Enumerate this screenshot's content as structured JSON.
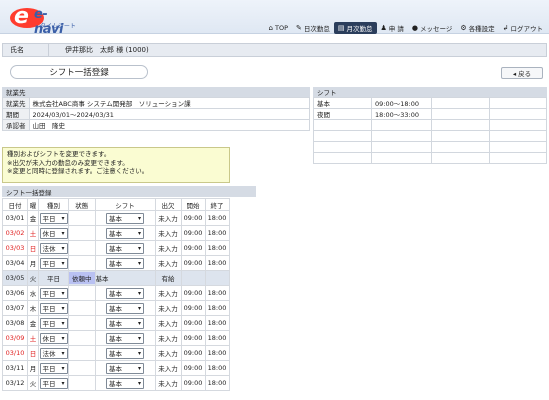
{
  "header": {
    "logo_main": "e-navi",
    "logo_sub": "タイムシート",
    "nav": [
      {
        "icon": "⌂",
        "icon_name": "home-icon",
        "label": "TOP",
        "active": false
      },
      {
        "icon": "✎",
        "icon_name": "pencil-icon",
        "label": "日次勤怠",
        "active": false
      },
      {
        "icon": "▤",
        "icon_name": "calendar-icon",
        "label": "月次勤怠",
        "active": true
      },
      {
        "icon": "♟",
        "icon_name": "person-icon",
        "label": "申 請",
        "active": false
      },
      {
        "icon": "●",
        "icon_name": "chat-icon",
        "label": "メッセージ",
        "active": false
      },
      {
        "icon": "⚙",
        "icon_name": "gear-icon",
        "label": "各種設定",
        "active": false
      },
      {
        "icon": "↲",
        "icon_name": "logout-icon",
        "label": "ログアウト",
        "active": false
      }
    ]
  },
  "user": {
    "label": "氏名",
    "value": "伊井那比　太郎 様 (1000)"
  },
  "page": {
    "title": "シフト一括登録",
    "back_label": "◂ 戻る"
  },
  "employment": {
    "title": "就業先",
    "rows": [
      {
        "key": "就業先",
        "value": "株式会社ABC商事 システム開発部　ソリューション課"
      },
      {
        "key": "期間",
        "value": "2024/03/01～2024/03/31"
      },
      {
        "key": "承認者",
        "value": "山田　隆史"
      }
    ]
  },
  "shift_panel": {
    "title": "シフト",
    "rows": [
      {
        "name": "基本",
        "time": "09:00～18:00"
      },
      {
        "name": "夜間",
        "time": "18:00～33:00"
      },
      {
        "name": "",
        "time": ""
      },
      {
        "name": "",
        "time": ""
      },
      {
        "name": "",
        "time": ""
      },
      {
        "name": "",
        "time": ""
      }
    ]
  },
  "note": {
    "lines": [
      "種別およびシフトを変更できます。",
      "※出欠が未入力の勤怠のみ変更できます。",
      "※変更と同時に登録されます。ご注意ください。"
    ]
  },
  "registration": {
    "title": "シフト一括登録",
    "columns": [
      "日付",
      "曜",
      "種別",
      "状態",
      "シフト",
      "出欠",
      "開始",
      "終了"
    ],
    "rows": [
      {
        "date": "03/01",
        "dow": "金",
        "red": false,
        "type": "平日",
        "status": "",
        "shift": "基本",
        "attendance": "未入力",
        "start": "09:00",
        "end": "18:00",
        "editable": true
      },
      {
        "date": "03/02",
        "dow": "土",
        "red": true,
        "type": "休日",
        "status": "",
        "shift": "基本",
        "attendance": "未入力",
        "start": "09:00",
        "end": "18:00",
        "editable": true
      },
      {
        "date": "03/03",
        "dow": "日",
        "red": true,
        "type": "法休",
        "status": "",
        "shift": "基本",
        "attendance": "未入力",
        "start": "09:00",
        "end": "18:00",
        "editable": true
      },
      {
        "date": "03/04",
        "dow": "月",
        "red": false,
        "type": "平日",
        "status": "",
        "shift": "基本",
        "attendance": "未入力",
        "start": "09:00",
        "end": "18:00",
        "editable": true
      },
      {
        "date": "03/05",
        "dow": "火",
        "red": false,
        "type": "平日",
        "status": "依頼中",
        "shift": "基本",
        "attendance": "有給",
        "start": "",
        "end": "",
        "editable": false
      },
      {
        "date": "03/06",
        "dow": "水",
        "red": false,
        "type": "平日",
        "status": "",
        "shift": "基本",
        "attendance": "未入力",
        "start": "09:00",
        "end": "18:00",
        "editable": true
      },
      {
        "date": "03/07",
        "dow": "木",
        "red": false,
        "type": "平日",
        "status": "",
        "shift": "基本",
        "attendance": "未入力",
        "start": "09:00",
        "end": "18:00",
        "editable": true
      },
      {
        "date": "03/08",
        "dow": "金",
        "red": false,
        "type": "平日",
        "status": "",
        "shift": "基本",
        "attendance": "未入力",
        "start": "09:00",
        "end": "18:00",
        "editable": true
      },
      {
        "date": "03/09",
        "dow": "土",
        "red": true,
        "type": "休日",
        "status": "",
        "shift": "基本",
        "attendance": "未入力",
        "start": "09:00",
        "end": "18:00",
        "editable": true
      },
      {
        "date": "03/10",
        "dow": "日",
        "red": true,
        "type": "法休",
        "status": "",
        "shift": "基本",
        "attendance": "未入力",
        "start": "09:00",
        "end": "18:00",
        "editable": true
      },
      {
        "date": "03/11",
        "dow": "月",
        "red": false,
        "type": "平日",
        "status": "",
        "shift": "基本",
        "attendance": "未入力",
        "start": "09:00",
        "end": "18:00",
        "editable": true
      },
      {
        "date": "03/12",
        "dow": "火",
        "red": false,
        "type": "平日",
        "status": "",
        "shift": "基本",
        "attendance": "未入力",
        "start": "09:00",
        "end": "18:00",
        "editable": true
      }
    ]
  }
}
